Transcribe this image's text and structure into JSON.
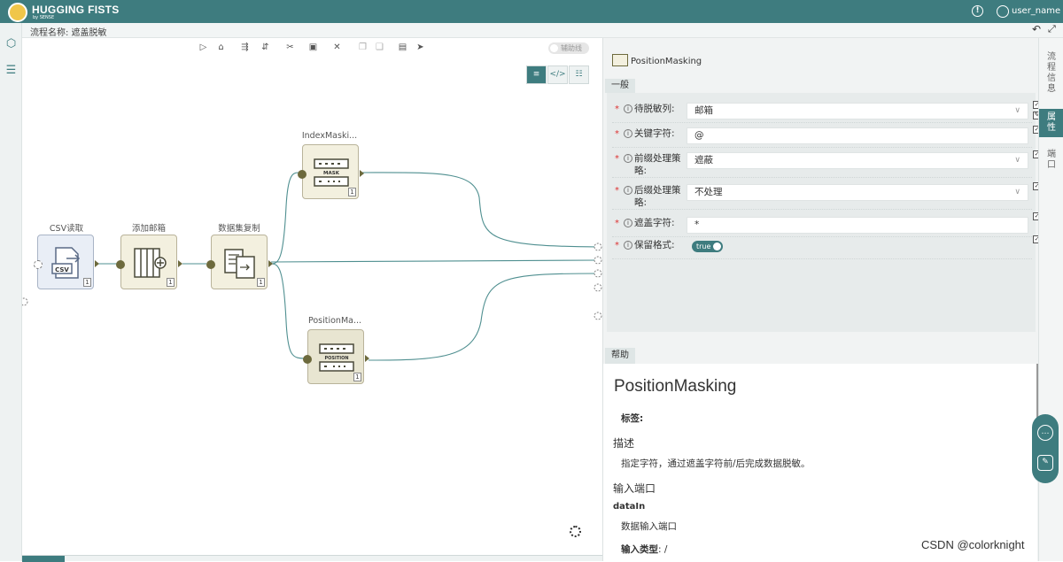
{
  "app": {
    "brand": "HUGGING FISTS",
    "brand_sub": "by SENSE",
    "user_name": "user_name"
  },
  "flow": {
    "label": "流程名称: 遮盖脱敏"
  },
  "canvas": {
    "aux_toggle_label": "辅助线",
    "nodes": [
      {
        "title": "CSV读取",
        "badge": "1",
        "icon_text": "CSV"
      },
      {
        "title": "添加邮箱",
        "badge": "1"
      },
      {
        "title": "数据集复制",
        "badge": "1"
      },
      {
        "title": "IndexMaski...",
        "badge": "1",
        "icon_text": "MASK"
      },
      {
        "title": "PositionMa...",
        "badge": "1",
        "icon_text": "POSITION"
      }
    ]
  },
  "panel": {
    "title": "PositionMasking",
    "section_general": "一般",
    "fields": [
      {
        "label": "待脱敏列:",
        "value": "邮箱",
        "type": "select"
      },
      {
        "label": "关键字符:",
        "value": "@",
        "type": "text"
      },
      {
        "label": "前缀处理策略:",
        "value": "遮蔽",
        "type": "select"
      },
      {
        "label": "后缀处理策略:",
        "value": "不处理",
        "type": "select"
      },
      {
        "label": "遮盖字符:",
        "value": "*",
        "type": "text"
      },
      {
        "label": "保留格式:",
        "value": "true",
        "type": "switch"
      }
    ],
    "help_tab": "帮助",
    "help": {
      "title": "PositionMasking",
      "tags_label": "标签:",
      "desc_heading": "描述",
      "desc_text": "指定字符，通过遮盖字符前/后完成数据脱敏。",
      "input_heading": "输入端口",
      "port_name": "dataIn",
      "port_desc": "数据输入端口",
      "input_type_label": "输入类型",
      "input_type_value": "/"
    }
  },
  "right_tabs": [
    "流程信息",
    "属性",
    "端口"
  ],
  "watermark": "CSDN @colorknight",
  "colors": {
    "accent": "#3e7c7f",
    "node_port": "#6d6a3d",
    "required": "#dd3333"
  }
}
